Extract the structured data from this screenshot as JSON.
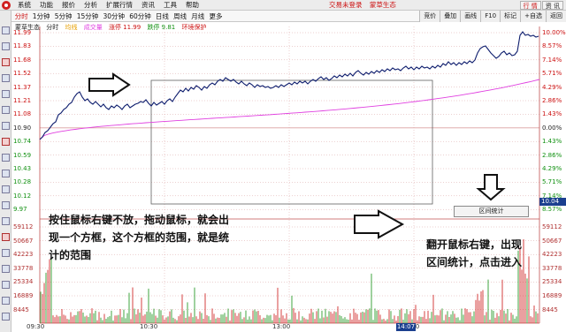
{
  "menu": {
    "items": [
      "系统",
      "功能",
      "报价",
      "分析",
      "扩展行情",
      "资讯",
      "工具",
      "帮助"
    ],
    "center_items": [
      "交易未登录",
      "蒙草生态"
    ],
    "right_buttons": [
      "行 情",
      "资 讯"
    ]
  },
  "toolbar": {
    "tabs": [
      "分时",
      "1分钟",
      "5分钟",
      "15分钟",
      "30分钟",
      "60分钟",
      "日线",
      "周线",
      "月线",
      "更多"
    ],
    "active_index": 0,
    "right_buttons": [
      "竞价",
      "叠加",
      "画线",
      "F10",
      "标记",
      "+自选",
      "返回"
    ]
  },
  "info": {
    "stock_name": "蒙草生态",
    "items": [
      "分时",
      "均线",
      "成交量",
      "涨停 11.99",
      "跌停 9.81",
      "环境保护"
    ]
  },
  "price_axis": {
    "left": [
      "11.99",
      "11.83",
      "11.68",
      "11.52",
      "11.37",
      "11.21",
      "11.08",
      "10.90",
      "10.74",
      "10.59",
      "10.43",
      "10.28",
      "10.12",
      "9.97"
    ],
    "right": [
      "10.00%",
      "8.57%",
      "7.14%",
      "5.71%",
      "4.29%",
      "2.86%",
      "1.43%",
      "0.00%",
      "1.43%",
      "2.86%",
      "4.29%",
      "5.71%",
      "7.14%",
      "8.57%"
    ]
  },
  "volume_axis": [
    "59112",
    "50667",
    "42223",
    "33778",
    "25334",
    "16889",
    "8445"
  ],
  "time_axis": [
    "09:30",
    "10:30",
    "13:00",
    "14:00"
  ],
  "cursor": {
    "price": "10.04",
    "time": "14:07"
  },
  "popup": {
    "label": "区间统计"
  },
  "annotations": {
    "left": [
      "按住鼠标右键不放，拖动鼠标，就会出",
      "现一个方框，这个方框的范围，就是统",
      "计的范围"
    ],
    "right": [
      "翻开鼠标右键，出现",
      "区间统计，点击进入"
    ]
  },
  "colors": {
    "price_line": "#0f1e6e",
    "avg_line": "#e040e0",
    "up": "#cc1111",
    "down": "#109010",
    "cursor_tag": "#1b3f8f"
  }
}
